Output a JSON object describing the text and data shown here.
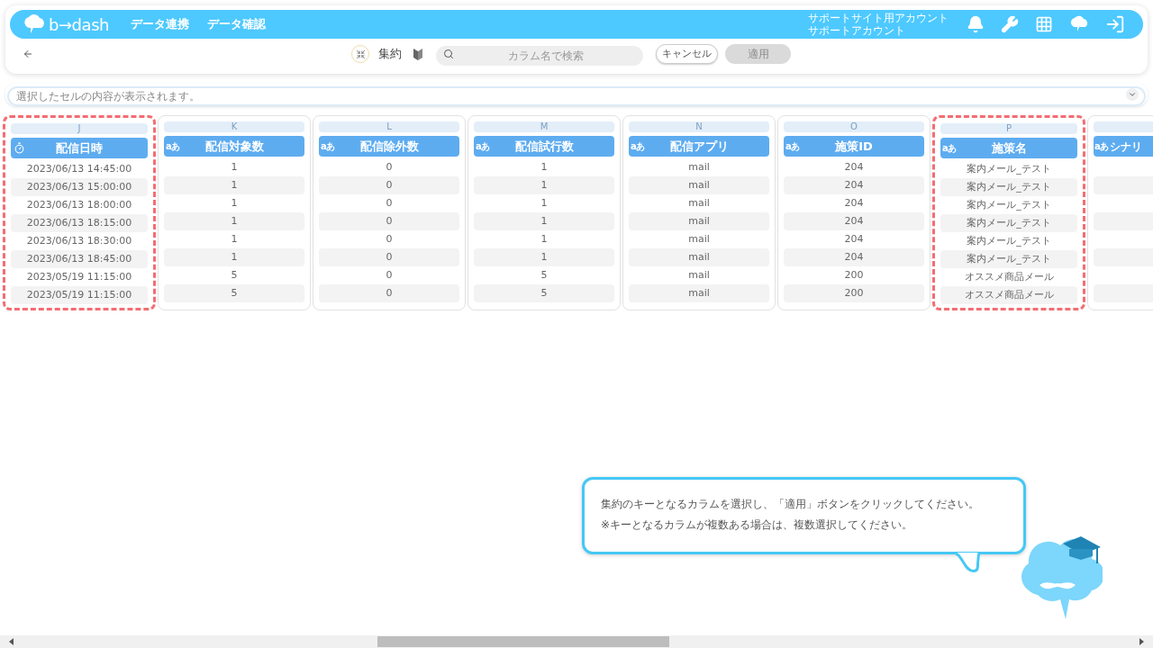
{
  "header": {
    "logo": "b→dash",
    "nav": [
      "データ連携",
      "データ確認"
    ],
    "account": [
      "サポートサイト用アカウント",
      "サポートアカウント"
    ]
  },
  "toolbar": {
    "title": "集約",
    "search": {
      "placeholder": "カラム名で検索"
    },
    "cancel": "キャンセル",
    "apply": {
      "label": "適用",
      "disabled": true
    }
  },
  "cell_view": {
    "placeholder": "選択したセルの内容が表示されます。"
  },
  "columns": [
    {
      "letter": "J",
      "kind": "datetime",
      "title": "配信日時",
      "selected": true,
      "rows": [
        "2023/06/13 14:45:00",
        "2023/06/13 15:00:00",
        "2023/06/13 18:00:00",
        "2023/06/13 18:15:00",
        "2023/06/13 18:30:00",
        "2023/06/13 18:45:00",
        "2023/05/19 11:15:00",
        "2023/05/19 11:15:00"
      ]
    },
    {
      "letter": "K",
      "kind": "text",
      "type_badge": "aあ",
      "title": "配信対象数",
      "selected": false,
      "rows": [
        "1",
        "1",
        "1",
        "1",
        "1",
        "1",
        "5",
        "5"
      ]
    },
    {
      "letter": "L",
      "kind": "text",
      "type_badge": "aあ",
      "title": "配信除外数",
      "selected": false,
      "rows": [
        "0",
        "0",
        "0",
        "0",
        "0",
        "0",
        "0",
        "0"
      ]
    },
    {
      "letter": "M",
      "kind": "text",
      "type_badge": "aあ",
      "title": "配信試行数",
      "selected": false,
      "rows": [
        "1",
        "1",
        "1",
        "1",
        "1",
        "1",
        "5",
        "5"
      ]
    },
    {
      "letter": "N",
      "kind": "text",
      "type_badge": "aあ",
      "title": "配信アプリ",
      "selected": false,
      "rows": [
        "mail",
        "mail",
        "mail",
        "mail",
        "mail",
        "mail",
        "mail",
        "mail"
      ]
    },
    {
      "letter": "O",
      "kind": "text",
      "type_badge": "aあ",
      "title": "施策ID",
      "selected": false,
      "rows": [
        "204",
        "204",
        "204",
        "204",
        "204",
        "204",
        "200",
        "200"
      ]
    },
    {
      "letter": "P",
      "kind": "text",
      "type_badge": "aあ",
      "title": "施策名",
      "selected": true,
      "rows": [
        "案内メール_テスト",
        "案内メール_テスト",
        "案内メール_テスト",
        "案内メール_テスト",
        "案内メール_テスト",
        "案内メール_テスト",
        "オススメ商品メール",
        "オススメ商品メール"
      ]
    },
    {
      "kind": "text",
      "type_badge": "aあ",
      "title": "シナリ",
      "selected": false
    }
  ],
  "guide": {
    "message": "集約のキーとなるカラムを選択し、「適用」ボタンをクリックしてください。",
    "note": "※キーとなるカラムが複数ある場合は、複数選択してください。"
  }
}
